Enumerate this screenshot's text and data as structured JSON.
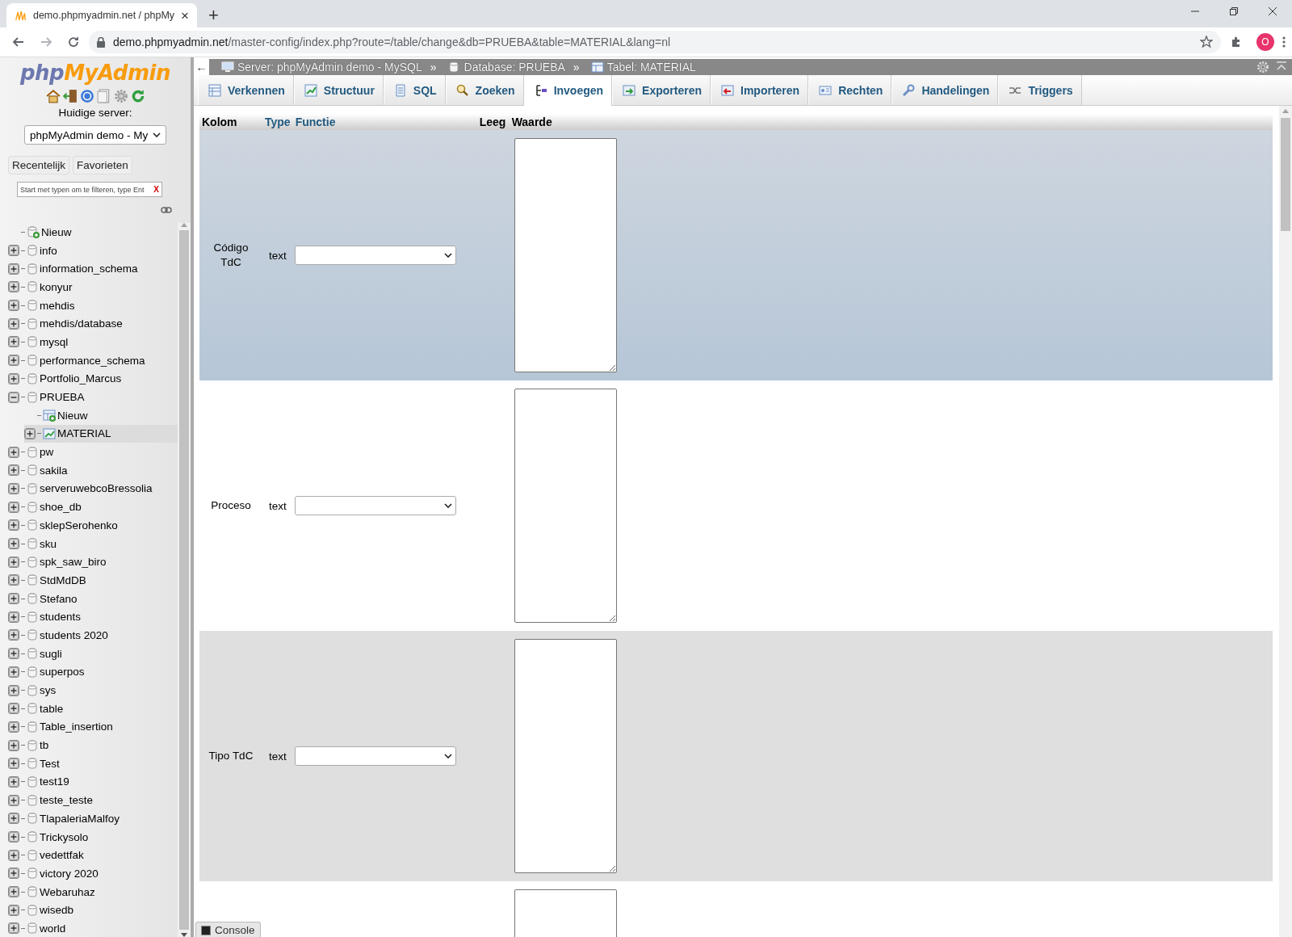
{
  "browser": {
    "tab_title": "demo.phpmyadmin.net / phpMy",
    "tab_close": "×",
    "new_tab": "+",
    "url_host": "demo.phpmyadmin.net",
    "url_path": "/master-config/index.php?route=/table/change&db=PRUEBA&table=MATERIAL&lang=nl",
    "profile": "O"
  },
  "sidebar": {
    "logo_a": "php",
    "logo_b": "MyAdmin",
    "server_label": "Huidige server:",
    "server_select": "phpMyAdmin demo - My",
    "buttons": [
      "Recentelijk",
      "Favorieten"
    ],
    "filter": {
      "placeholder": "Start met typen om te filteren, type Ent",
      "clear": "X"
    },
    "tree": [
      {
        "label": "Nieuw",
        "kind": "new",
        "selected": false
      },
      {
        "label": "info",
        "kind": "database",
        "expanded": false,
        "selected": false
      },
      {
        "label": "information_schema",
        "kind": "database",
        "expanded": false,
        "selected": false
      },
      {
        "label": "konyur",
        "kind": "database",
        "expanded": false,
        "selected": false
      },
      {
        "label": "mehdis",
        "kind": "database",
        "expanded": false,
        "selected": false
      },
      {
        "label": "mehdis/database",
        "kind": "database",
        "expanded": false,
        "selected": false
      },
      {
        "label": "mysql",
        "kind": "database",
        "expanded": false,
        "selected": false
      },
      {
        "label": "performance_schema",
        "kind": "database",
        "expanded": false,
        "selected": false
      },
      {
        "label": "Portfolio_Marcus",
        "kind": "database",
        "expanded": false,
        "selected": false
      },
      {
        "label": "PRUEBA",
        "kind": "database",
        "expanded": true,
        "selected": false,
        "children": [
          {
            "label": "Nieuw",
            "kind": "new-table",
            "selected": false
          },
          {
            "label": "MATERIAL",
            "kind": "table",
            "expanded": false,
            "selected": true
          }
        ]
      },
      {
        "label": "pw",
        "kind": "database",
        "expanded": false,
        "selected": false
      },
      {
        "label": "sakila",
        "kind": "database",
        "expanded": false,
        "selected": false
      },
      {
        "label": "serveruwebcoBressolia",
        "kind": "database",
        "expanded": false,
        "selected": false
      },
      {
        "label": "shoe_db",
        "kind": "database",
        "expanded": false,
        "selected": false
      },
      {
        "label": "sklepSerohenko",
        "kind": "database",
        "expanded": false,
        "selected": false
      },
      {
        "label": "sku",
        "kind": "database",
        "expanded": false,
        "selected": false
      },
      {
        "label": "spk_saw_biro",
        "kind": "database",
        "expanded": false,
        "selected": false
      },
      {
        "label": "StdMdDB",
        "kind": "database",
        "expanded": false,
        "selected": false
      },
      {
        "label": "Stefano",
        "kind": "database",
        "expanded": false,
        "selected": false
      },
      {
        "label": "students",
        "kind": "database",
        "expanded": false,
        "selected": false
      },
      {
        "label": "students 2020",
        "kind": "database",
        "expanded": false,
        "selected": false
      },
      {
        "label": "sugli",
        "kind": "database",
        "expanded": false,
        "selected": false
      },
      {
        "label": "superpos",
        "kind": "database",
        "expanded": false,
        "selected": false
      },
      {
        "label": "sys",
        "kind": "database",
        "expanded": false,
        "selected": false
      },
      {
        "label": "table",
        "kind": "database",
        "expanded": false,
        "selected": false
      },
      {
        "label": "Table_insertion",
        "kind": "database",
        "expanded": false,
        "selected": false
      },
      {
        "label": "tb",
        "kind": "database",
        "expanded": false,
        "selected": false
      },
      {
        "label": "Test",
        "kind": "database",
        "expanded": false,
        "selected": false
      },
      {
        "label": "test19",
        "kind": "database",
        "expanded": false,
        "selected": false
      },
      {
        "label": "teste_teste",
        "kind": "database",
        "expanded": false,
        "selected": false
      },
      {
        "label": "TlapaleriaMalfoy",
        "kind": "database",
        "expanded": false,
        "selected": false
      },
      {
        "label": "Trickysolo",
        "kind": "database",
        "expanded": false,
        "selected": false
      },
      {
        "label": "vedettfak",
        "kind": "database",
        "expanded": false,
        "selected": false
      },
      {
        "label": "victory 2020",
        "kind": "database",
        "expanded": false,
        "selected": false
      },
      {
        "label": "Webaruhaz",
        "kind": "database",
        "expanded": false,
        "selected": false
      },
      {
        "label": "wisedb",
        "kind": "database",
        "expanded": false,
        "selected": false
      },
      {
        "label": "world",
        "kind": "database",
        "expanded": false,
        "selected": false
      }
    ]
  },
  "breadcrumb": {
    "back": "←",
    "items": [
      {
        "label": "Server: phpMyAdmin demo - MySQL",
        "kind": "server"
      },
      {
        "label": "Database: PRUEBA",
        "kind": "database"
      },
      {
        "label": "Tabel: MATERIAL",
        "kind": "table"
      }
    ],
    "separator": "»"
  },
  "tabs": [
    {
      "label": "Verkennen",
      "kind": "browse",
      "selected": false
    },
    {
      "label": "Structuur",
      "kind": "structure",
      "selected": false
    },
    {
      "label": "SQL",
      "kind": "sql",
      "selected": false
    },
    {
      "label": "Zoeken",
      "kind": "search",
      "selected": false
    },
    {
      "label": "Invoegen",
      "kind": "insert",
      "selected": true
    },
    {
      "label": "Exporteren",
      "kind": "export",
      "selected": false
    },
    {
      "label": "Importeren",
      "kind": "import",
      "selected": false
    },
    {
      "label": "Rechten",
      "kind": "privileges",
      "selected": false
    },
    {
      "label": "Handelingen",
      "kind": "operations",
      "selected": false
    },
    {
      "label": "Triggers",
      "kind": "triggers",
      "selected": false
    }
  ],
  "table": {
    "columns": [
      "Kolom",
      "Type",
      "Functie",
      "Leeg",
      "Waarde"
    ],
    "rows": [
      {
        "name": "Código TdC",
        "type": "text",
        "highlighted": true
      },
      {
        "name": "Proceso",
        "type": "text",
        "highlighted": false
      },
      {
        "name": "Tipo TdC",
        "type": "text",
        "highlighted": false
      },
      {
        "highlighted": false
      }
    ]
  },
  "console": "Console"
}
